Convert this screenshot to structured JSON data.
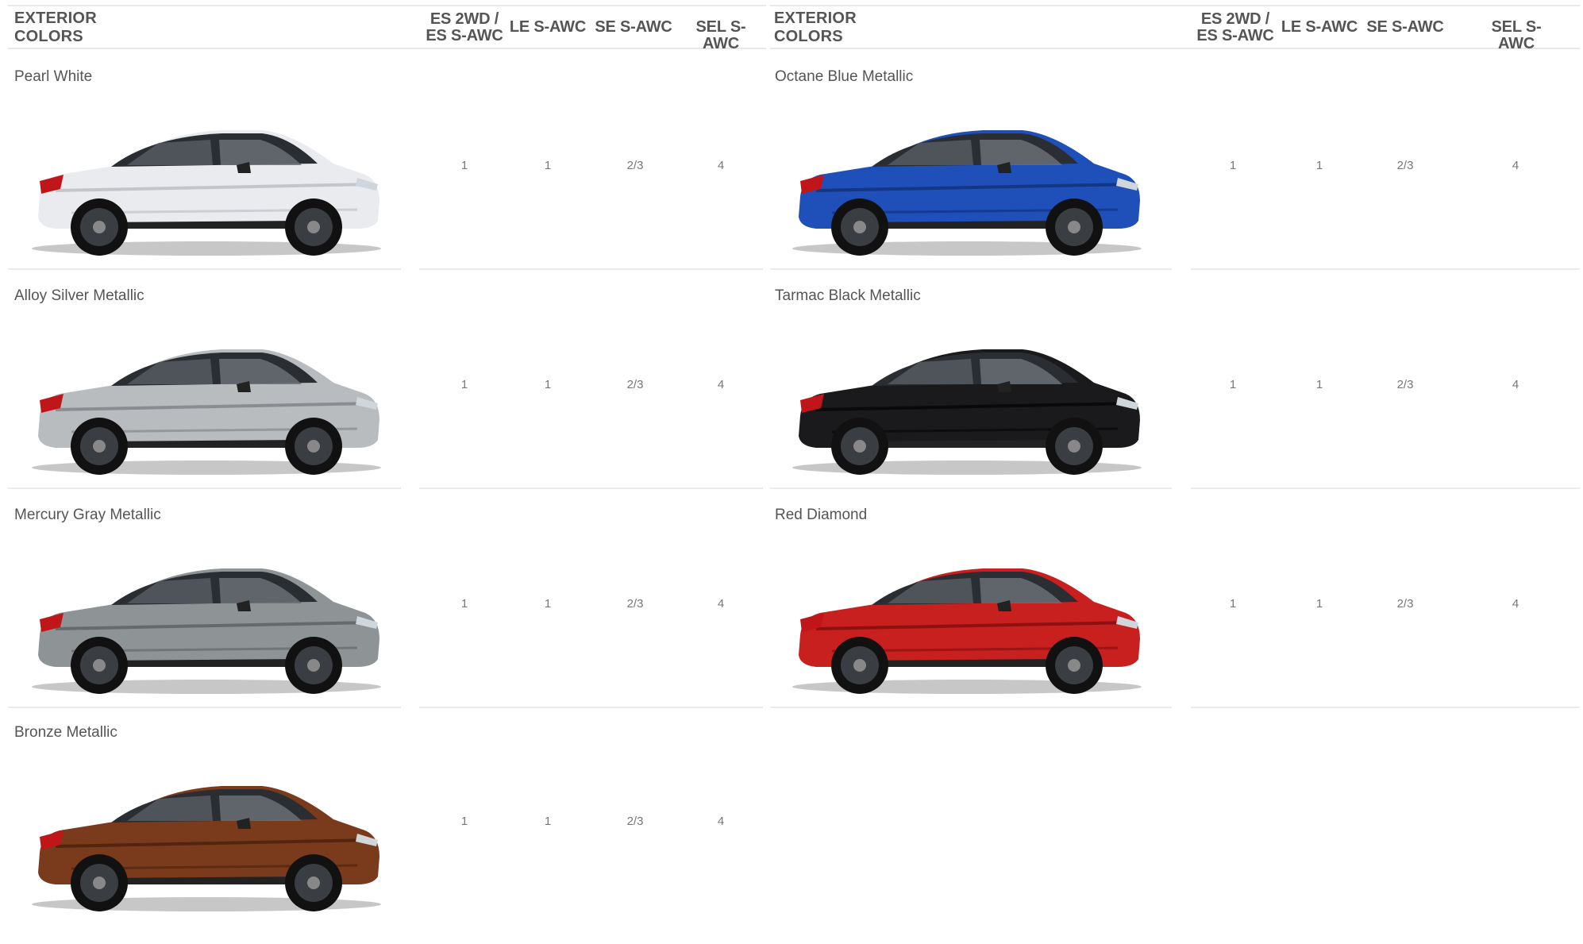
{
  "left_table": {
    "title": "EXTERIOR COLORS",
    "columns": [
      "ES 2WD /\nES S-AWC",
      "LE S-AWC",
      "SE S-AWC",
      "SEL S-AWC"
    ],
    "rows": [
      {
        "name": "Pearl White",
        "values": [
          "1",
          "1",
          "2/3",
          "4"
        ],
        "body_color": "#e9ebee",
        "shade_color": "#b9bcc2"
      },
      {
        "name": "Alloy Silver Metallic",
        "values": [
          "1",
          "1",
          "2/3",
          "4"
        ],
        "body_color": "#b9bcbf",
        "shade_color": "#7d8084"
      },
      {
        "name": "Mercury Gray Metallic",
        "values": [
          "1",
          "1",
          "2/3",
          "4"
        ],
        "body_color": "#8e9396",
        "shade_color": "#5b6063"
      },
      {
        "name": "Bronze Metallic",
        "values": [
          "1",
          "1",
          "2/3",
          "4"
        ],
        "body_color": "#7a3a1c",
        "shade_color": "#4a200d"
      }
    ]
  },
  "right_table": {
    "title": "EXTERIOR COLORS",
    "columns": [
      "ES 2WD /\nES S-AWC",
      "LE S-AWC",
      "SE S-AWC",
      "SEL S-AWC"
    ],
    "rows": [
      {
        "name": "Octane Blue Metallic",
        "values": [
          "1",
          "1",
          "2/3",
          "4"
        ],
        "body_color": "#1f4fb8",
        "shade_color": "#102f78"
      },
      {
        "name": "Tarmac Black Metallic",
        "values": [
          "1",
          "1",
          "2/3",
          "4"
        ],
        "body_color": "#1a1a1c",
        "shade_color": "#050506"
      },
      {
        "name": "Red Diamond",
        "values": [
          "1",
          "1",
          "2/3",
          "4"
        ],
        "body_color": "#c81f1f",
        "shade_color": "#7e0e0e"
      }
    ]
  }
}
